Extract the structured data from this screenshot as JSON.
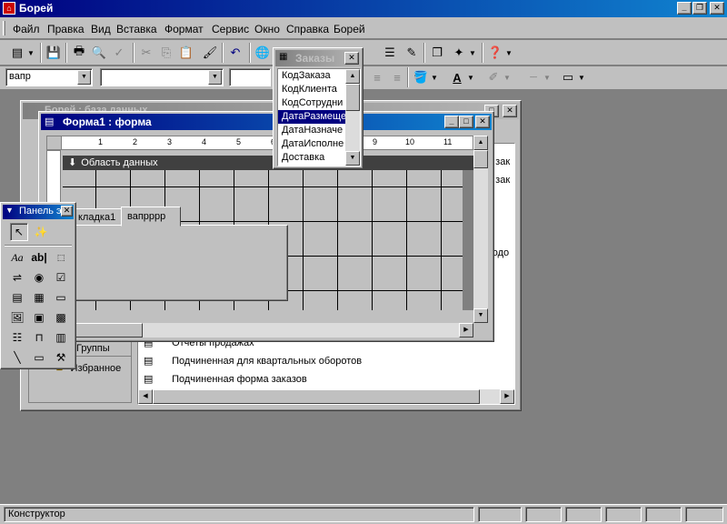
{
  "app": {
    "title": "Борей"
  },
  "menu": {
    "file": "Файл",
    "edit": "Правка",
    "view": "Вид",
    "insert": "Вставка",
    "format": "Формат",
    "tools": "Сервис",
    "window": "Окно",
    "help": "Справка",
    "borei": "Борей"
  },
  "format_toolbar": {
    "object_value": "вапр",
    "font_value": "",
    "size_value": ""
  },
  "db_window": {
    "title": "Борей : база данных",
    "group_items": [
      "Группы",
      "Избранное"
    ],
    "objects": [
      "Отчеты продажах",
      "Подчиненная для квартальных оборотов",
      "Подчиненная форма заказов"
    ],
    "right_fragments": [
      "а зак",
      "а зак",
      "водо"
    ]
  },
  "form_window": {
    "title": "Форма1 : форма",
    "ruler_marks": [
      "1",
      "2",
      "3",
      "4",
      "5",
      "6",
      "7",
      "8",
      "9",
      "10",
      "11"
    ],
    "section_label": "Область данных",
    "tabs": [
      "кладка1",
      "вапрррр"
    ]
  },
  "field_list": {
    "title": "Заказы",
    "fields": [
      "КодЗаказа",
      "КодКлиента",
      "КодСотрудни",
      "ДатаРазмеще",
      "ДатаНазначе",
      "ДатаИсполне",
      "Доставка"
    ],
    "selected_index": 3
  },
  "toolbox": {
    "title": "Панель э"
  },
  "status": {
    "text": "Конструктор"
  },
  "colors": {
    "title_active": "#000080",
    "title_inactive": "#808080",
    "face": "#c0c0c0",
    "desktop": "#808080"
  }
}
